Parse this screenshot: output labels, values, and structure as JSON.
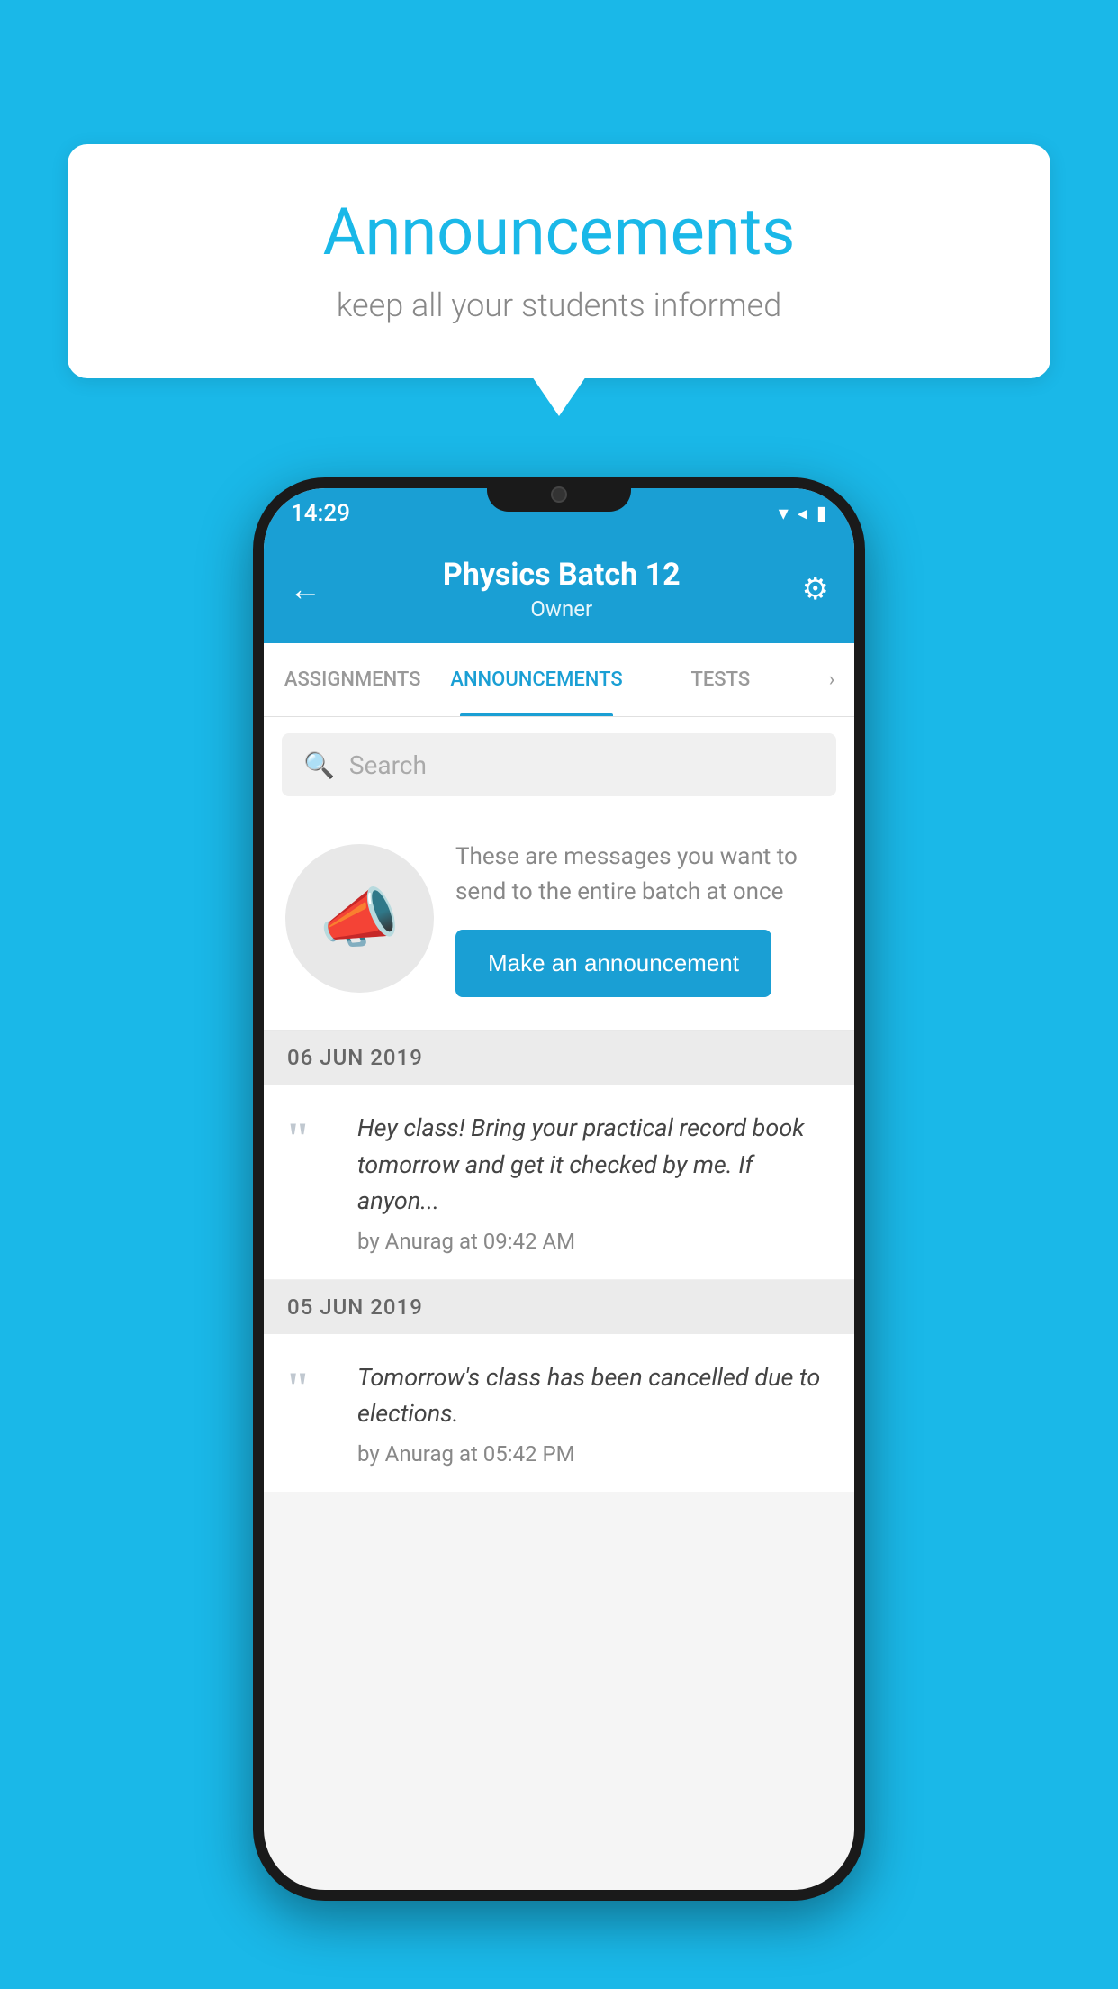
{
  "page": {
    "background_color": "#1ab8e8"
  },
  "speech_bubble": {
    "title": "Announcements",
    "subtitle": "keep all your students informed"
  },
  "phone": {
    "status_bar": {
      "time": "14:29",
      "icons": [
        "wifi",
        "signal",
        "battery"
      ]
    },
    "header": {
      "title": "Physics Batch 12",
      "subtitle": "Owner",
      "back_label": "←",
      "gear_label": "⚙"
    },
    "tabs": [
      {
        "label": "ASSIGNMENTS",
        "active": false
      },
      {
        "label": "ANNOUNCEMENTS",
        "active": true
      },
      {
        "label": "TESTS",
        "active": false
      }
    ],
    "tabs_more": "›",
    "search": {
      "placeholder": "Search"
    },
    "promo_card": {
      "text": "These are messages you want to send to the entire batch at once",
      "button_label": "Make an announcement"
    },
    "announcements": [
      {
        "date": "06  JUN  2019",
        "text": "Hey class! Bring your practical record book tomorrow and get it checked by me. If anyon...",
        "meta": "by Anurag at 09:42 AM"
      },
      {
        "date": "05  JUN  2019",
        "text": "Tomorrow's class has been cancelled due to elections.",
        "meta": "by Anurag at 05:42 PM"
      }
    ]
  }
}
